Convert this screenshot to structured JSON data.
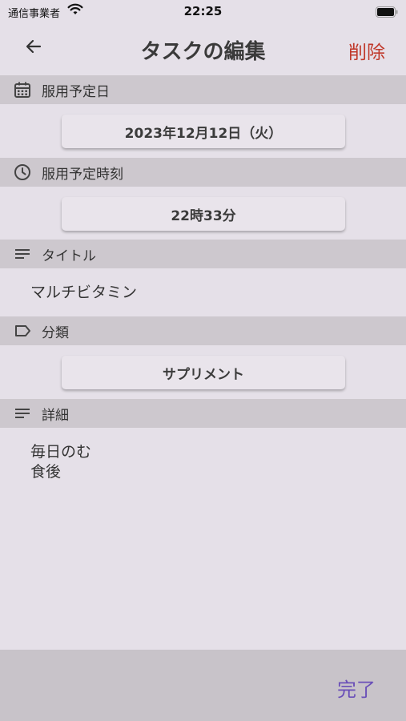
{
  "status_bar": {
    "carrier": "通信事業者",
    "time": "22:25"
  },
  "nav": {
    "title": "タスクの編集",
    "delete_label": "削除"
  },
  "sections": {
    "date": {
      "label": "服用予定日",
      "value": "2023年12月12日（火）"
    },
    "time": {
      "label": "服用予定時刻",
      "value": "22時33分"
    },
    "title": {
      "label": "タイトル",
      "value": "マルチビタミン"
    },
    "category": {
      "label": "分類",
      "value": "サプリメント"
    },
    "detail": {
      "label": "詳細",
      "lines": [
        "毎日のむ",
        "食後"
      ]
    }
  },
  "footer": {
    "done_label": "完了"
  },
  "colors": {
    "delete": "#c0392b",
    "done": "#6a4fb8",
    "header_bg": "#cdc8ce",
    "page_bg": "#e5e0e8"
  }
}
